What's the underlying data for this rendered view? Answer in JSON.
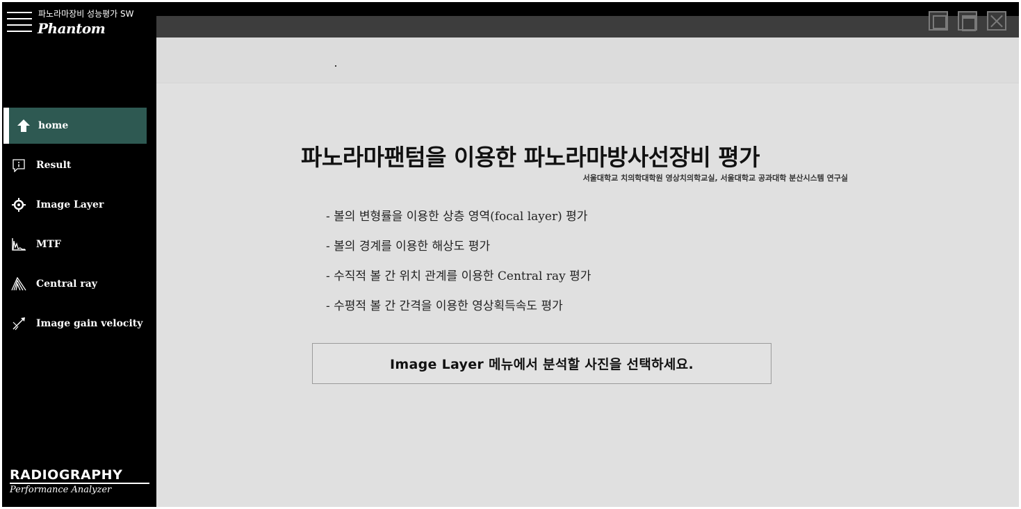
{
  "sidebar": {
    "app_title": "파노라마장비 성능평가 SW",
    "app_logo": "Phantom",
    "items": [
      {
        "label": "home",
        "icon": "home-icon",
        "active": true
      },
      {
        "label": "Result",
        "icon": "result-icon",
        "active": false
      },
      {
        "label": "Image Layer",
        "icon": "crosshair-icon",
        "active": false
      },
      {
        "label": "MTF",
        "icon": "mtf-graph-icon",
        "active": false
      },
      {
        "label": "Central ray",
        "icon": "central-ray-icon",
        "active": false
      },
      {
        "label": "Image gain velocity",
        "icon": "velocity-icon",
        "active": false
      }
    ],
    "brand_main": "RADIOGRAPHY",
    "brand_sub": "Performance Analyzer"
  },
  "window_controls": [
    "minimize",
    "maximize",
    "close"
  ],
  "main": {
    "title": "파노라마팬텀을 이용한 파노라마방사선장비 평가",
    "affiliation": "서울대학교 치의학대학원 영상치의학교실, 서울대학교 공과대학 분산시스템 연구실",
    "features": [
      "- 볼의 변형률을 이용한 상층 영역(focal layer) 평가",
      "- 볼의 경계를 이용한 해상도 평가",
      "- 수직적 볼 간 위치 관계를 이용한 Central ray 평가",
      "- 수평적 볼 간 간격을 이용한 영상획득속도 평가"
    ],
    "instruction": "Image  Layer 메뉴에서 분석할 사진을 선택하세요."
  },
  "colors": {
    "sidebar_bg": "#000000",
    "active_item": "#2e5952",
    "content_bg": "#e0e0e0",
    "titlebar_strip": "#3d3d3d"
  }
}
